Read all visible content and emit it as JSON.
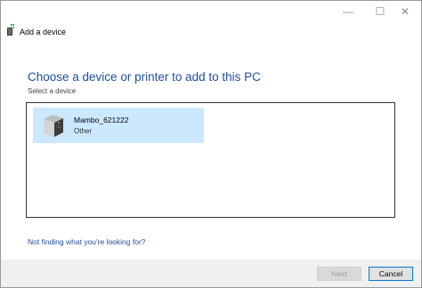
{
  "window": {
    "minimize_icon": "—",
    "maximize_icon": "☐",
    "close_icon": "✕"
  },
  "header": {
    "title": "Add a device",
    "icon": "add-device-icon"
  },
  "main": {
    "heading": "Choose a device or printer to add to this PC",
    "subheading": "Select a device",
    "devices": [
      {
        "name": "Mambo_621222",
        "type": "Other",
        "icon": "device-box-icon",
        "selected": true
      }
    ],
    "help_link": "Not finding what you're looking for?"
  },
  "footer": {
    "next_label": "Next",
    "next_enabled": false,
    "cancel_label": "Cancel"
  },
  "colors": {
    "heading": "#1f4d9b",
    "selection": "#cce8ff",
    "footer_bg": "#f0f0f0"
  }
}
